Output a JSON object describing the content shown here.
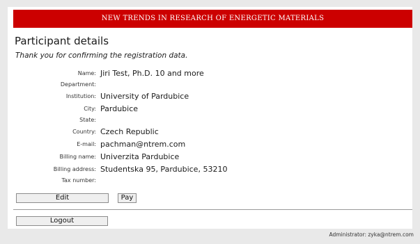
{
  "header": {
    "banner_title": "NEW TRENDS IN RESEARCH OF ENERGETIC MATERIALS",
    "banner_color": "#cc0000"
  },
  "main": {
    "page_title": "Participant details",
    "confirmation_message": "Thank you for confirming the registration data."
  },
  "participant": {
    "fields": [
      {
        "label": "Name:",
        "value": "Jiri Test, Ph.D. 10 and more"
      },
      {
        "label": "Department:",
        "value": ""
      },
      {
        "label": "Institution:",
        "value": "University of Pardubice"
      },
      {
        "label": "City:",
        "value": "Pardubice"
      },
      {
        "label": "State:",
        "value": ""
      },
      {
        "label": "Country:",
        "value": "Czech Republic"
      },
      {
        "label": "E-mail:",
        "value": "pachman@ntrem.com"
      },
      {
        "label": "Billing name:",
        "value": "Univerzita Pardubice"
      },
      {
        "label": "Billing address:",
        "value": "Studentska 95, Pardubice, 53210"
      },
      {
        "label": "Tax number:",
        "value": ""
      }
    ]
  },
  "actions": {
    "edit_label": "Edit",
    "pay_label": "Pay",
    "logout_label": "Logout"
  },
  "footer": {
    "admin_text": "Administrator: zyka@ntrem.com"
  }
}
